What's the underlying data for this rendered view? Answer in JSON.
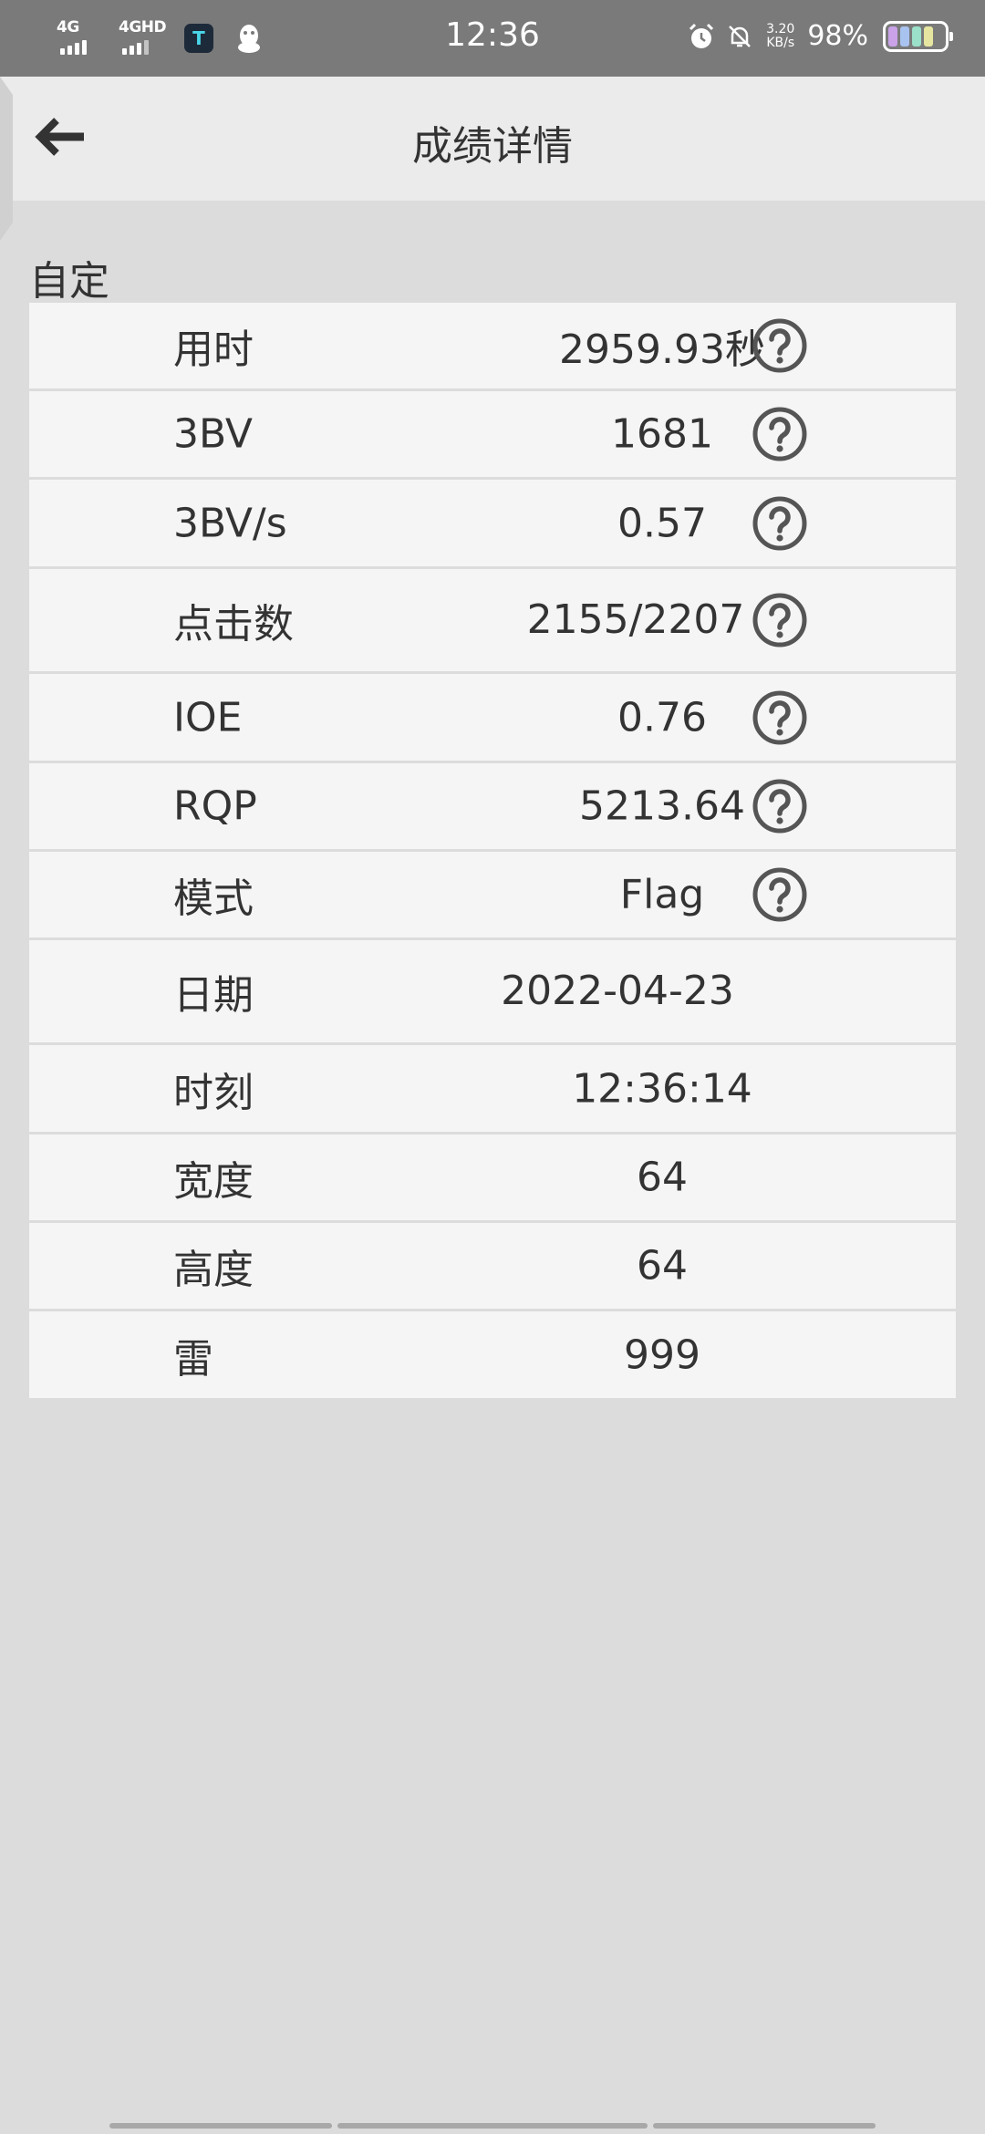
{
  "status_bar": {
    "signal1_label": "4G",
    "signal2_label": "4GHD",
    "app_icon_glyph": "T",
    "time": "12:36",
    "speed_value": "3.20",
    "speed_unit": "KB/s",
    "battery_percent": "98%"
  },
  "header": {
    "title": "成绩详情",
    "back_icon": "arrow-left-icon"
  },
  "section": {
    "label": "自定"
  },
  "rows": [
    {
      "label": "用时",
      "value": "2959.93秒",
      "help": true
    },
    {
      "label": "3BV",
      "value": "1681",
      "help": true
    },
    {
      "label": "3BV/s",
      "value": "0.57",
      "help": true
    },
    {
      "label": "点击数",
      "value": "2155/2207",
      "help": true
    },
    {
      "label": "IOE",
      "value": "0.76",
      "help": true
    },
    {
      "label": "RQP",
      "value": "5213.64",
      "help": true
    },
    {
      "label": "模式",
      "value": "Flag",
      "help": true
    },
    {
      "label": "日期",
      "value": "2022-04-23",
      "help": false
    },
    {
      "label": "时刻",
      "value": "12:36:14",
      "help": false
    },
    {
      "label": "宽度",
      "value": "64",
      "help": false
    },
    {
      "label": "高度",
      "value": "64",
      "help": false
    },
    {
      "label": "雷",
      "value": "999",
      "help": false
    }
  ],
  "colors": {
    "status_bar": "#7a7a7a",
    "app_bar": "#ebebeb",
    "background": "#dcdcdc",
    "row": "#f5f5f5",
    "icon": "#555555"
  }
}
